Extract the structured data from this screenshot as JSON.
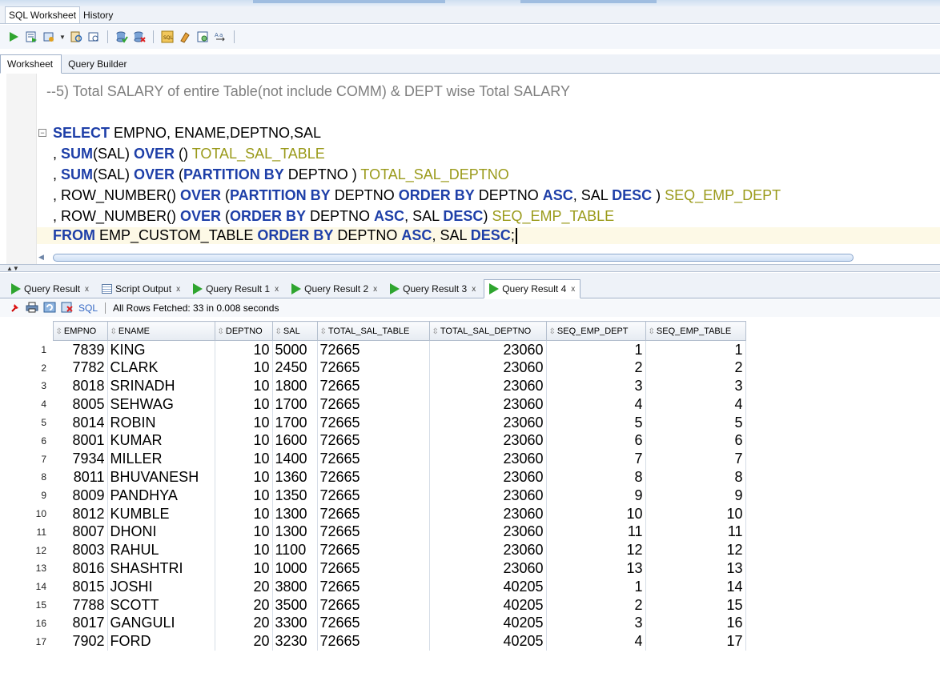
{
  "window_tabs": [
    {
      "label": "SQL Worksheet",
      "active": true
    },
    {
      "label": "History",
      "active": false
    }
  ],
  "toolbar_icons": [
    "run-statement-icon",
    "run-script-icon",
    "autotrace-icon",
    "explain-plan-icon",
    "sql-tuning-icon",
    "commit-icon",
    "rollback-icon",
    "sql-translator-icon",
    "clear-icon",
    "history-icon",
    "format-icon"
  ],
  "editor_tabs": [
    {
      "label": "Worksheet",
      "active": true
    },
    {
      "label": "Query Builder",
      "active": false
    }
  ],
  "editor": {
    "comment": "--5) Total SALARY of entire Table(not include COMM) & DEPT wise Total SALARY",
    "line1": {
      "kw": "SELECT",
      "rest": " EMPNO, ENAME,DEPTNO,SAL"
    },
    "line2": {
      "pre": ", ",
      "fn": "SUM",
      "mid": "(SAL) ",
      "kw": "OVER",
      "post": " () ",
      "alias": "TOTAL_SAL_TABLE"
    },
    "line3": {
      "pre": ", ",
      "fn": "SUM",
      "mid": "(SAL) ",
      "kw1": "OVER",
      "mid2": " (",
      "kw2": "PARTITION BY",
      "post": " DEPTNO ) ",
      "alias": "TOTAL_SAL_DEPTNO"
    },
    "line4": {
      "pre": ", ROW_NUMBER() ",
      "kw1": "OVER",
      "mid": " (",
      "kw2": "PARTITION BY",
      "mid2": " DEPTNO ",
      "kw3": "ORDER BY",
      "mid3": " DEPTNO ",
      "kw4": "ASC",
      "mid4": ", SAL ",
      "kw5": "DESC",
      "post": " ) ",
      "alias": "SEQ_EMP_DEPT"
    },
    "line5": {
      "pre": ", ROW_NUMBER() ",
      "kw1": "OVER",
      "mid": " (",
      "kw2": "ORDER BY",
      "mid2": " DEPTNO ",
      "kw3": "ASC",
      "mid3": ", SAL ",
      "kw4": "DESC",
      "post": ") ",
      "alias": "SEQ_EMP_TABLE"
    },
    "line6": {
      "kw1": "FROM",
      "mid": " EMP_CUSTOM_TABLE ",
      "kw2": "ORDER BY",
      "mid2": " DEPTNO ",
      "kw3": "ASC",
      "mid3": ", SAL ",
      "kw4": "DESC",
      "post": ";"
    }
  },
  "result_tabs": [
    {
      "label": "Query Result",
      "icon": "play-icon",
      "active": false
    },
    {
      "label": "Script Output",
      "icon": "script-icon",
      "active": false
    },
    {
      "label": "Query Result 1",
      "icon": "play-icon",
      "active": false
    },
    {
      "label": "Query Result 2",
      "icon": "play-icon",
      "active": false
    },
    {
      "label": "Query Result 3",
      "icon": "play-icon",
      "active": false
    },
    {
      "label": "Query Result 4",
      "icon": "play-icon",
      "active": true
    }
  ],
  "result_toolbar": {
    "sql_label": "SQL",
    "status": "All Rows Fetched: 33 in 0.008 seconds"
  },
  "grid": {
    "columns": [
      "EMPNO",
      "ENAME",
      "DEPTNO",
      "SAL",
      "TOTAL_SAL_TABLE",
      "TOTAL_SAL_DEPTNO",
      "SEQ_EMP_DEPT",
      "SEQ_EMP_TABLE"
    ],
    "rows": [
      [
        "1",
        "7839",
        "KING",
        "10",
        "5000",
        "72665",
        "23060",
        "1",
        "1"
      ],
      [
        "2",
        "7782",
        "CLARK",
        "10",
        "2450",
        "72665",
        "23060",
        "2",
        "2"
      ],
      [
        "3",
        "8018",
        "SRINADH",
        "10",
        "1800",
        "72665",
        "23060",
        "3",
        "3"
      ],
      [
        "4",
        "8005",
        "SEHWAG",
        "10",
        "1700",
        "72665",
        "23060",
        "4",
        "4"
      ],
      [
        "5",
        "8014",
        "ROBIN",
        "10",
        "1700",
        "72665",
        "23060",
        "5",
        "5"
      ],
      [
        "6",
        "8001",
        "KUMAR",
        "10",
        "1600",
        "72665",
        "23060",
        "6",
        "6"
      ],
      [
        "7",
        "7934",
        "MILLER",
        "10",
        "1400",
        "72665",
        "23060",
        "7",
        "7"
      ],
      [
        "8",
        "8011",
        "BHUVANESH",
        "10",
        "1360",
        "72665",
        "23060",
        "8",
        "8"
      ],
      [
        "9",
        "8009",
        "PANDHYA",
        "10",
        "1350",
        "72665",
        "23060",
        "9",
        "9"
      ],
      [
        "10",
        "8012",
        "KUMBLE",
        "10",
        "1300",
        "72665",
        "23060",
        "10",
        "10"
      ],
      [
        "11",
        "8007",
        "DHONI",
        "10",
        "1300",
        "72665",
        "23060",
        "11",
        "11"
      ],
      [
        "12",
        "8003",
        "RAHUL",
        "10",
        "1100",
        "72665",
        "23060",
        "12",
        "12"
      ],
      [
        "13",
        "8016",
        "SHASHTRI",
        "10",
        "1000",
        "72665",
        "23060",
        "13",
        "13"
      ],
      [
        "14",
        "8015",
        "JOSHI",
        "20",
        "3800",
        "72665",
        "40205",
        "1",
        "14"
      ],
      [
        "15",
        "7788",
        "SCOTT",
        "20",
        "3500",
        "72665",
        "40205",
        "2",
        "15"
      ],
      [
        "16",
        "8017",
        "GANGULI",
        "20",
        "3300",
        "72665",
        "40205",
        "3",
        "16"
      ],
      [
        "17",
        "7902",
        "FORD",
        "20",
        "3230",
        "72665",
        "40205",
        "4",
        "17"
      ]
    ]
  }
}
